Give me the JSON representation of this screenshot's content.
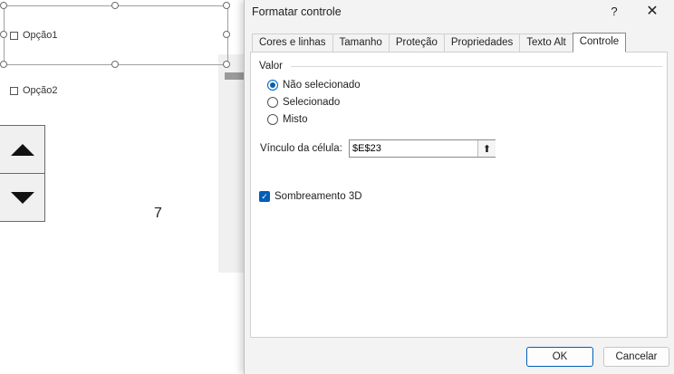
{
  "sheet": {
    "option1_label": "Opção1",
    "option2_label": "Opção2",
    "cell_value": "7"
  },
  "dialog": {
    "title": "Formatar controle",
    "help": "?",
    "close": "✕",
    "tabs": [
      {
        "label": "Cores e linhas"
      },
      {
        "label": "Tamanho"
      },
      {
        "label": "Proteção"
      },
      {
        "label": "Propriedades"
      },
      {
        "label": "Texto Alt"
      },
      {
        "label": "Controle"
      }
    ],
    "active_tab": "Controle",
    "valor": {
      "group_label": "Valor",
      "options": [
        {
          "label": "Não selecionado",
          "selected": true
        },
        {
          "label": "Selecionado",
          "selected": false
        },
        {
          "label": "Misto",
          "selected": false
        }
      ]
    },
    "cell_link": {
      "label": "Vínculo da célula:",
      "value": "$E$23"
    },
    "shading": {
      "label": "Sombreamento 3D",
      "checked": true
    },
    "ok_label": "OK",
    "cancel_label": "Cancelar"
  },
  "colors": {
    "accent": "#005fb8"
  }
}
